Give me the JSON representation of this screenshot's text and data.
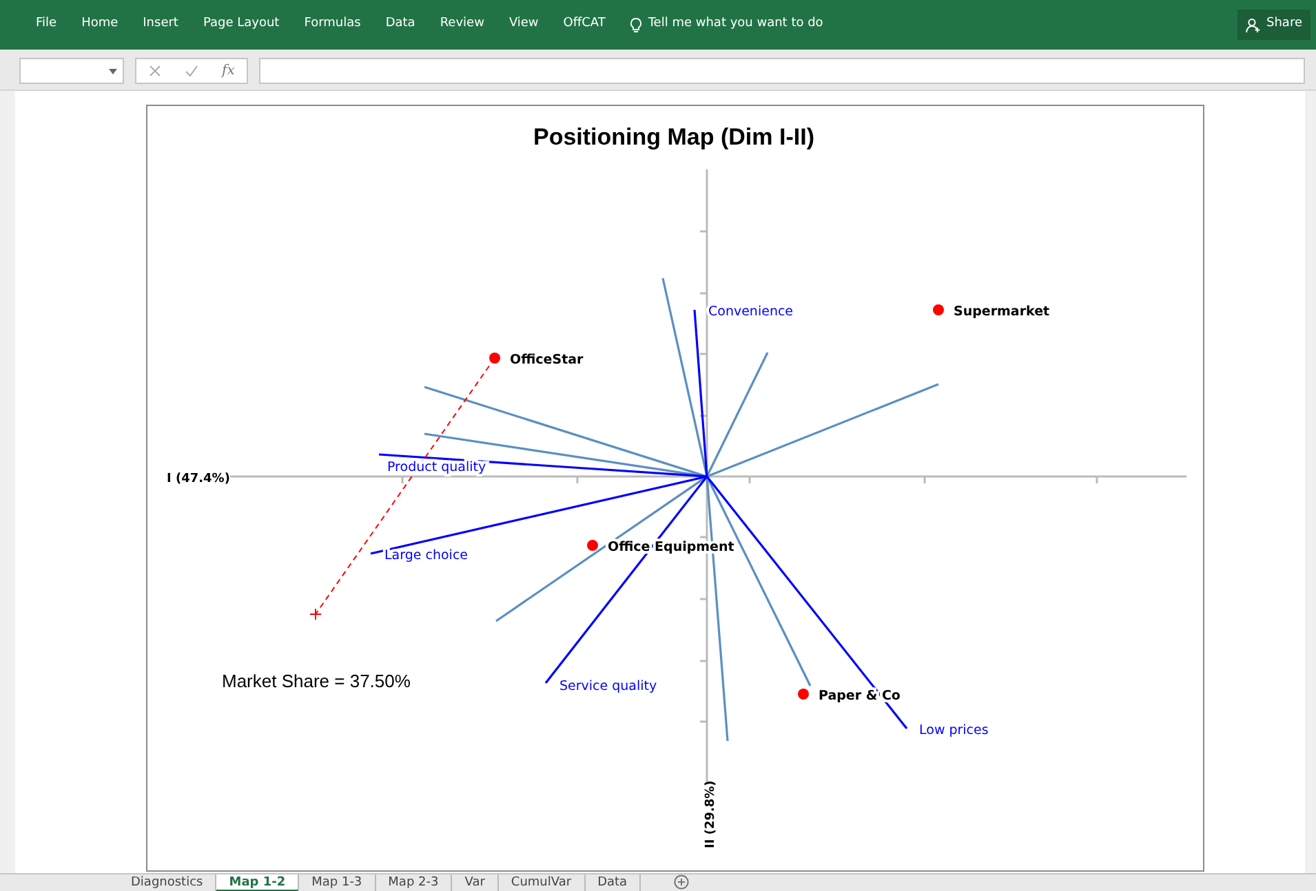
{
  "ribbon": {
    "tabs": [
      {
        "label": "File"
      },
      {
        "label": "Home"
      },
      {
        "label": "Insert"
      },
      {
        "label": "Page Layout"
      },
      {
        "label": "Formulas"
      },
      {
        "label": "Data"
      },
      {
        "label": "Review"
      },
      {
        "label": "View"
      },
      {
        "label": "OffCAT"
      }
    ],
    "tell_me": "Tell me what you want to do",
    "share": "Share"
  },
  "formula_bar": {
    "fx": "fx"
  },
  "chart": {
    "title": "Positioning Map (Dim I-II)",
    "x_axis_label": "I (47.4%)",
    "y_axis_label": "II (29.8%)",
    "vectors": [
      {
        "label": "Convenience",
        "kind": "labeled"
      },
      {
        "label": "Product quality",
        "kind": "labeled"
      },
      {
        "label": "Large choice",
        "kind": "labeled"
      },
      {
        "label": "Service quality",
        "kind": "labeled"
      },
      {
        "label": "Low prices",
        "kind": "labeled"
      }
    ],
    "points": [
      {
        "label": "OfficeStar",
        "color": "#ff0000"
      },
      {
        "label": "Supermarket",
        "color": "#ff0000"
      },
      {
        "label": "Office Equipment",
        "color": "#ff0000"
      },
      {
        "label": "Paper & Co",
        "color": "#ff0000"
      }
    ],
    "annotation": "Market Share = 37.50%"
  },
  "sheet_tabs": [
    {
      "label": "Diagnostics",
      "selected": false
    },
    {
      "label": "Map 1-2",
      "selected": true
    },
    {
      "label": "Map 1-3",
      "selected": false
    },
    {
      "label": "Map 2-3",
      "selected": false
    },
    {
      "label": "Var",
      "selected": false
    },
    {
      "label": "CumulVar",
      "selected": false
    },
    {
      "label": "Data",
      "selected": false
    }
  ]
}
